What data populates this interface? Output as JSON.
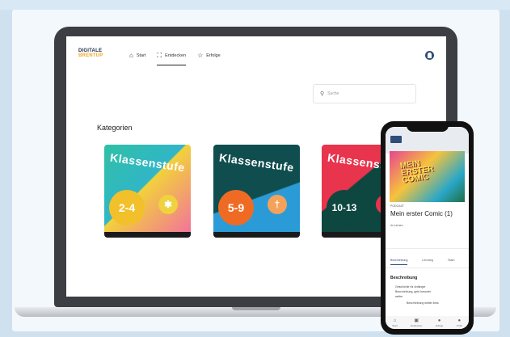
{
  "logo": {
    "line1": "DIGITALE",
    "line2": "BRENTUP"
  },
  "nav": [
    {
      "icon": "⌂",
      "icon_name": "home-icon",
      "label": "Start"
    },
    {
      "icon": "⛶",
      "icon_name": "binoculars-icon",
      "label": "Entdecken"
    },
    {
      "icon": "☆",
      "icon_name": "star-icon",
      "label": "Erfolge"
    }
  ],
  "search": {
    "placeholder": "Suche"
  },
  "categories": {
    "title": "Kategorien",
    "cards": [
      {
        "title": "Klassenstufe",
        "range": "2-4",
        "icon": "✱"
      },
      {
        "title": "Klassenstufe",
        "range": "5-9",
        "icon": "†"
      },
      {
        "title": "Klassenstufe",
        "range": "10-13",
        "icon": "●"
      }
    ]
  },
  "phone": {
    "cover_title": "MEIN ERSTER COMIC",
    "kicker": "PODCAST",
    "title": "Mein erster Comic (1)",
    "meta": "4x Lernen",
    "tabs": [
      "Beschreibung",
      "Lernweg",
      "Team"
    ],
    "description_title": "Beschreibung",
    "description_lines": [
      "Geschichte für Anfänger",
      "Beschreibung, geht herunter",
      "weiter",
      "Beschreibung weiter links"
    ],
    "bottom_nav": [
      {
        "icon": "⌂",
        "label": "Start"
      },
      {
        "icon": "▣",
        "label": "Entdecken"
      },
      {
        "icon": "●",
        "label": "Erfolge"
      },
      {
        "icon": "●",
        "label": "Profil"
      }
    ]
  },
  "colors": {
    "accent": "#2e4d7a",
    "logo_accent": "#f0a82c"
  }
}
